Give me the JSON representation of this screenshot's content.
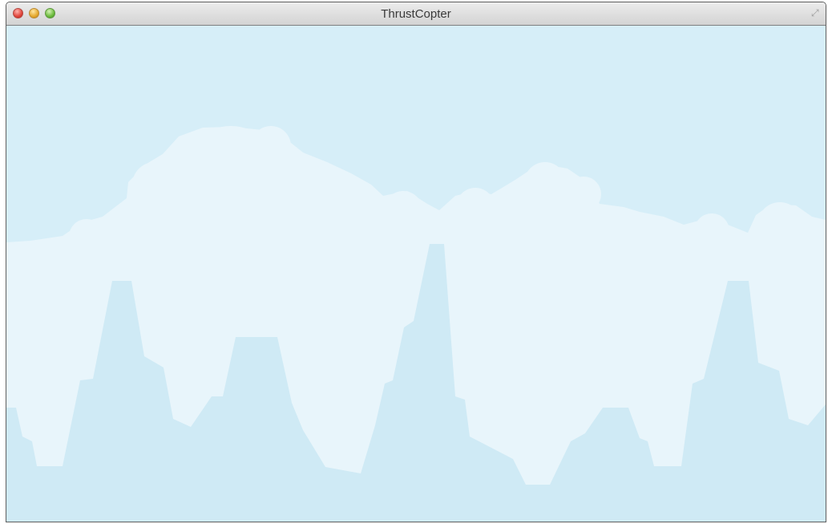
{
  "window": {
    "title": "ThrustCopter",
    "controls": [
      "close-icon",
      "minimize-icon",
      "zoom-icon"
    ],
    "fullscreen_icon": "fullscreen-icon"
  },
  "scene": {
    "sky_color": "#d6eef8",
    "cloud_color": "#e8f5fb",
    "rock_color": "#cfeaf5"
  }
}
